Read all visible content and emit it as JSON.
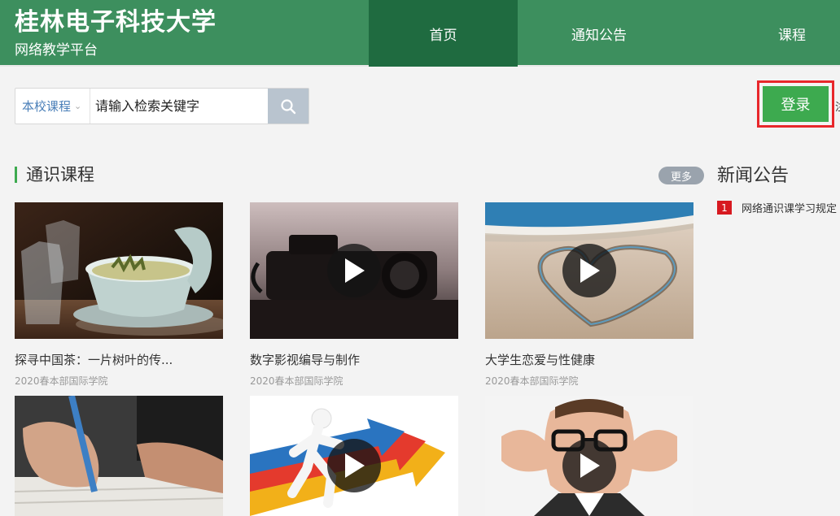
{
  "header": {
    "brand_title": "桂林电子科技大学",
    "brand_subtitle": "网络教学平台",
    "nav": [
      {
        "label": "首页",
        "active": true
      },
      {
        "label": "通知公告",
        "active": false
      },
      {
        "label": "课程",
        "active": false
      }
    ]
  },
  "search": {
    "scope": "本校课程",
    "placeholder": "请输入检索关键字"
  },
  "login": {
    "label": "登录",
    "side_text": "注"
  },
  "section": {
    "title": "通识课程",
    "more": "更多"
  },
  "news": {
    "title": "新闻公告",
    "items": [
      {
        "num": "1",
        "text": "网络通识课学习规定"
      }
    ]
  },
  "courses": [
    {
      "title": "探寻中国茶：一片树叶的传...",
      "subtitle": "2020春本部国际学院",
      "thumb": "tea-cups-image",
      "play": false
    },
    {
      "title": "数字影视编导与制作",
      "subtitle": "2020春本部国际学院",
      "thumb": "camera-image",
      "play": true
    },
    {
      "title": "大学生恋爱与性健康",
      "subtitle": "2020春本部国际学院",
      "thumb": "heart-sand-image",
      "play": true
    },
    {
      "title": "",
      "subtitle": "",
      "thumb": "writing-hand-image",
      "play": false
    },
    {
      "title": "",
      "subtitle": "",
      "thumb": "arrows-runner-image",
      "play": true
    },
    {
      "title": "",
      "subtitle": "",
      "thumb": "man-covering-ears-image",
      "play": true
    }
  ],
  "colors": {
    "header_green": "#3d8f5e",
    "nav_active": "#1f6b40",
    "login_green": "#3daa4f",
    "highlight_red": "#e8272b",
    "news_badge": "#d71920"
  }
}
